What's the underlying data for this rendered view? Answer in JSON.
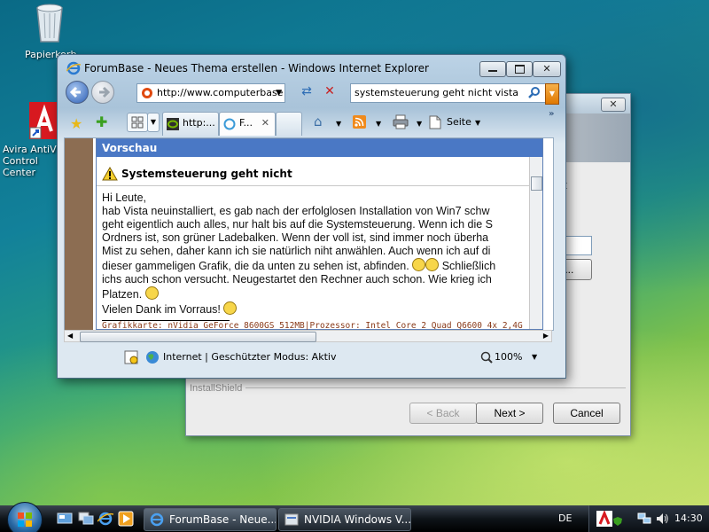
{
  "desktop": {
    "icons": [
      {
        "label": "Papierkorb"
      },
      {
        "label": "Avira AntiVir Control Center"
      }
    ]
  },
  "installer": {
    "group_label": "InstallShield",
    "back_label": "< Back",
    "next_label": "Next >",
    "cancel_label": "Cancel",
    "browse_label": "e...",
    "close_glyph": "✕",
    "side_char": "t"
  },
  "ie": {
    "title": "ForumBase - Neues Thema erstellen - Windows Internet Explorer",
    "address": "http://www.computerbase",
    "search": "systemsteuerung geht nicht vista",
    "tabs": [
      {
        "label": "http:..."
      },
      {
        "label": "F..."
      }
    ],
    "toolbar": {
      "page_label": "Seite"
    },
    "status": {
      "zone": "Internet | Geschützter Modus: Aktiv",
      "zoom": "100%"
    }
  },
  "preview": {
    "header": "Vorschau",
    "title": "Systemsteuerung geht nicht",
    "lines": [
      "Hi Leute,",
      "hab Vista neuinstalliert, es gab nach der erfolglosen Installation von Win7 schw",
      "geht eigentlich auch alles, nur halt bis auf die Systemsteuerung. Wenn ich die S",
      "Ordners ist, son grüner Ladebalken. Wenn der voll ist, sind immer noch überha",
      "Mist zu sehen, daher kann ich sie natürlich niht anwählen. Auch wenn ich auf di",
      "dieser gammeligen Grafik, die da unten zu sehen ist, abfinden.",
      "ichs auch schon versucht. Neugestartet den Rechner auch schon. Wie krieg ich",
      "Platzen.",
      "Vielen Dank im Vorraus!"
    ],
    "line5_tail": "Schließlich",
    "signature": "Grafikkarte: nVidia GeForce 8600GS 512MB|Prozessor: Intel Core 2 Quad Q6600 4x 2,4G"
  },
  "taskbar": {
    "windows": [
      {
        "label": "ForumBase - Neue..."
      },
      {
        "label": "NVIDIA Windows V..."
      }
    ],
    "language": "DE",
    "clock": "14:30"
  },
  "colors": {
    "preview_header": "#4a78c5",
    "signature": "#8a3b1a"
  }
}
